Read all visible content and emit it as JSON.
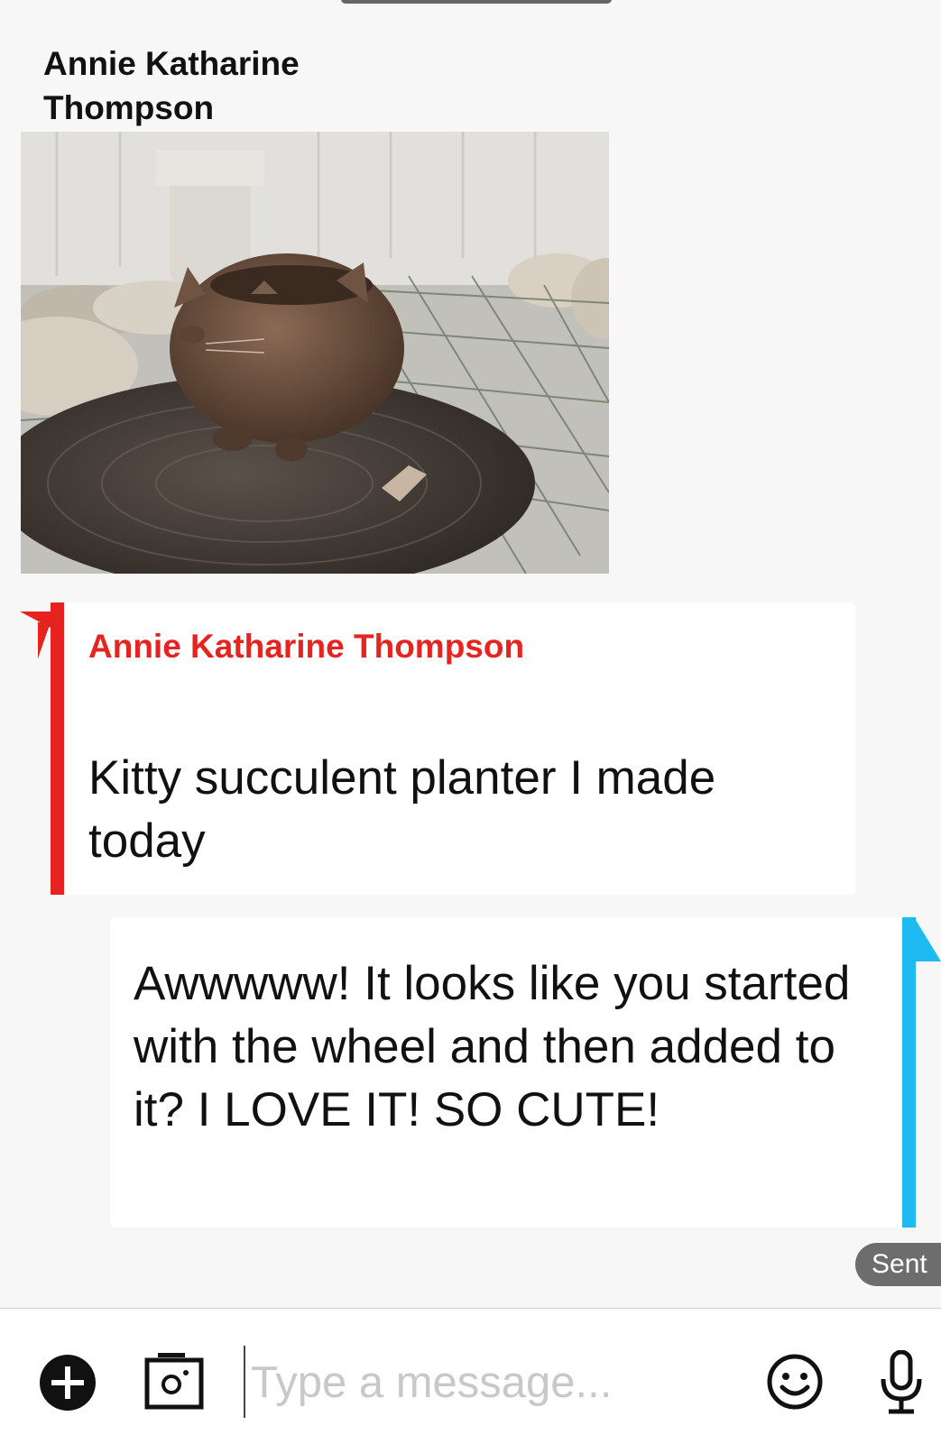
{
  "incoming": {
    "sender_name": "Annie Katharine Thompson",
    "photo_description_icon": "pottery-photo",
    "author": "Annie Katharine Thompson",
    "text": "Kitty succulent planter I made today",
    "accent_color": "#e7231f"
  },
  "outgoing": {
    "text": "Awwwww! It looks like you started with the wheel and then added to it? I LOVE IT! SO CUTE!",
    "accent_color": "#1dbbf2",
    "status": "Sent"
  },
  "composer": {
    "placeholder": "Type a message...",
    "value": "",
    "icons": [
      "plus-icon",
      "camera-icon",
      "emoji-icon",
      "microphone-icon"
    ]
  }
}
